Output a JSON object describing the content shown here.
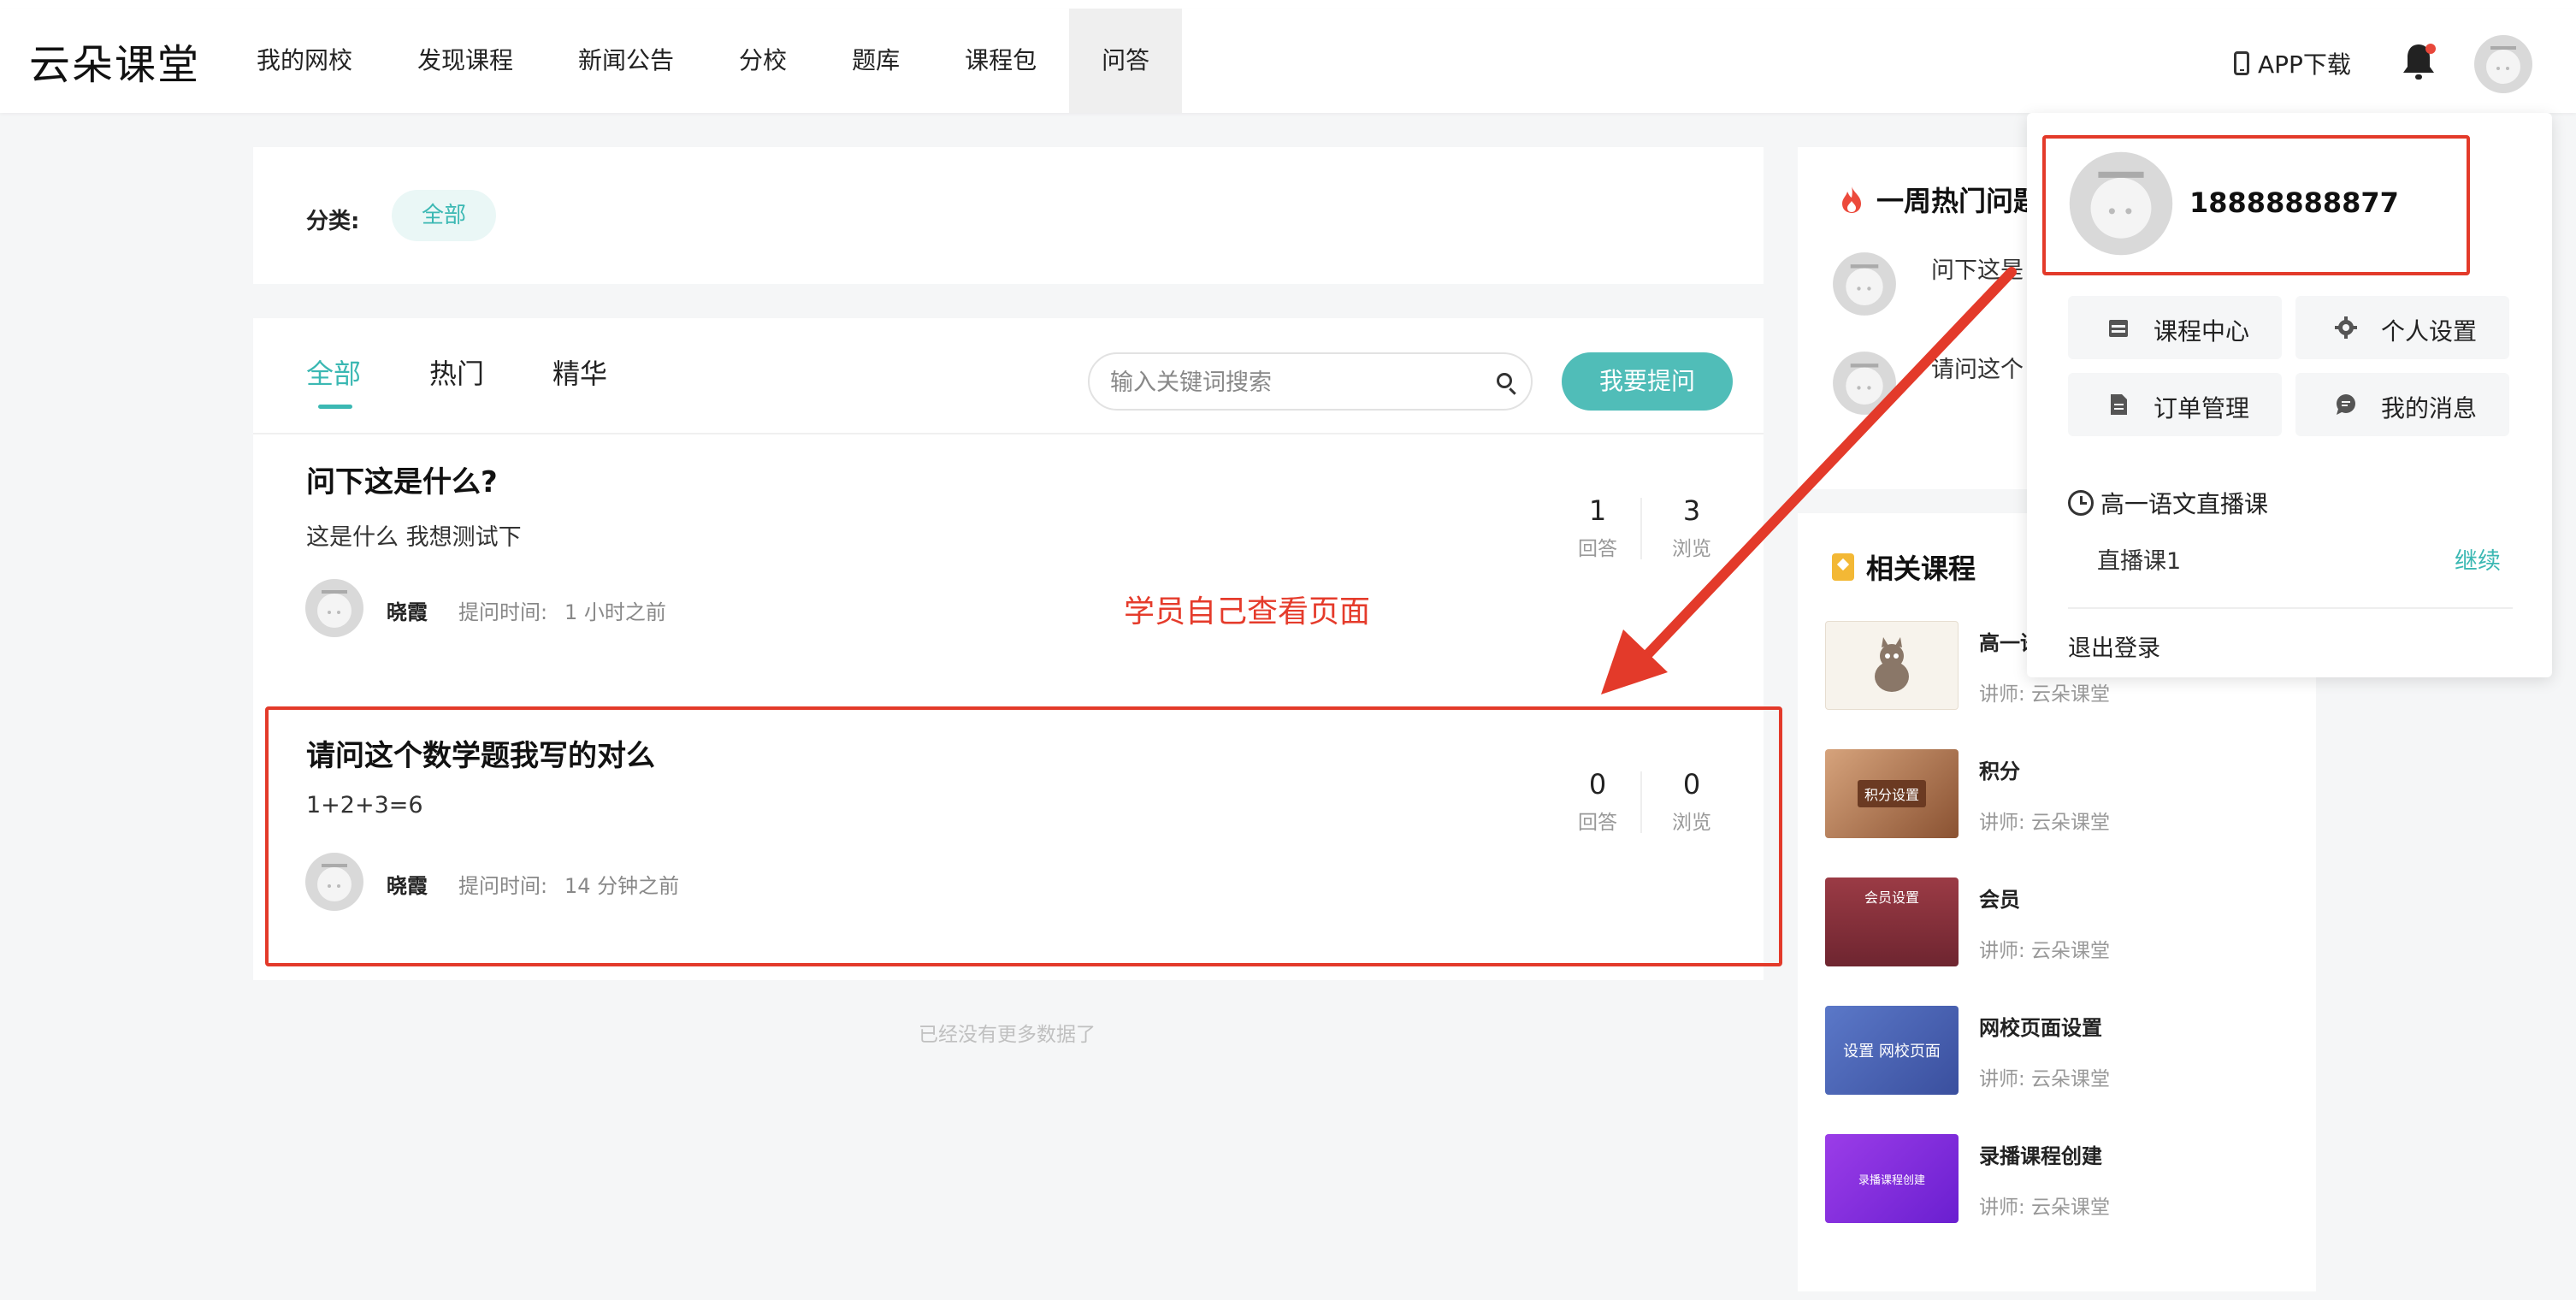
{
  "header": {
    "logo": "云朵课堂",
    "nav": [
      "我的网校",
      "发现课程",
      "新闻公告",
      "分校",
      "题库",
      "课程包",
      "问答"
    ],
    "active_nav_index": 6,
    "app_download": "APP下载"
  },
  "category": {
    "label": "分类:",
    "chip": "全部"
  },
  "tabs": [
    "全部",
    "热门",
    "精华"
  ],
  "search": {
    "placeholder": "输入关键词搜索"
  },
  "ask_button": "我要提问",
  "stats_labels": {
    "answers": "回答",
    "views": "浏览"
  },
  "questions": [
    {
      "title": "问下这是什么?",
      "body": "这是什么  我想测试下",
      "author": "晓霞",
      "time_label": "提问时间:",
      "time": "1 小时之前",
      "answers": "1",
      "views": "3"
    },
    {
      "title": "请问这个数学题我写的对么",
      "body": "1+2+3=6",
      "author": "晓霞",
      "time_label": "提问时间:",
      "time": "14 分钟之前",
      "answers": "0",
      "views": "0"
    }
  ],
  "annotation": "学员自己查看页面",
  "no_more": "已经没有更多数据了",
  "hot": {
    "title": "一周热门问题",
    "items": [
      "问下这是",
      "请问这个"
    ]
  },
  "related": {
    "title": "相关课程",
    "courses": [
      {
        "title": "高一语",
        "teacher": "讲师: 云朵课堂",
        "thumb_text": ""
      },
      {
        "title": "积分",
        "teacher": "讲师: 云朵课堂",
        "thumb_text": "积分设置"
      },
      {
        "title": "会员",
        "teacher": "讲师: 云朵课堂",
        "thumb_text": "会员设置"
      },
      {
        "title": "网校页面设置",
        "teacher": "讲师: 云朵课堂",
        "thumb_text": "设置 网校页面"
      },
      {
        "title": "录播课程创建",
        "teacher": "讲师: 云朵课堂",
        "thumb_text": "录播课程创建"
      }
    ]
  },
  "dropdown": {
    "phone": "18888888877",
    "buttons": [
      "课程中心",
      "个人设置",
      "订单管理",
      "我的消息"
    ],
    "section_title": "高一语文直播课",
    "lesson": "直播课1",
    "continue": "继续",
    "logout": "退出登录"
  },
  "colors": {
    "accent": "#3bb8b3",
    "annotation_red": "#e33a2a"
  }
}
